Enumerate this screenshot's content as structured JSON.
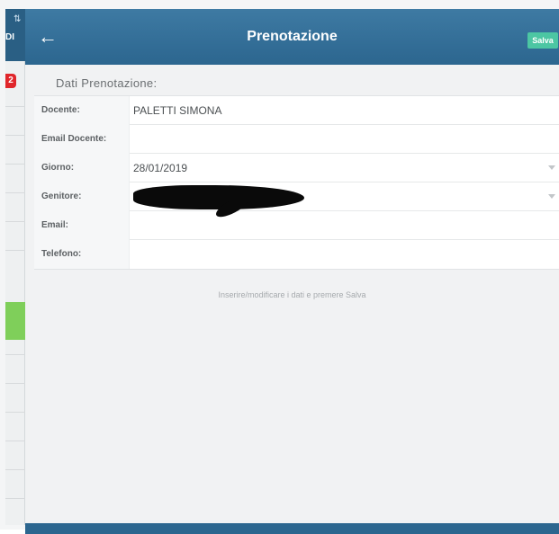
{
  "sidebar": {
    "header_text": "DI",
    "badge": "2"
  },
  "navbar": {
    "title": "Prenotazione",
    "back_icon": "arrow-left-icon",
    "save_label": "Salva"
  },
  "form": {
    "section_title": "Dati Prenotazione:",
    "rows": [
      {
        "label": "Docente:",
        "value": "PALETTI SIMONA"
      },
      {
        "label": "Email Docente:",
        "value": ""
      },
      {
        "label": "Giorno:",
        "value": "28/01/2019"
      },
      {
        "label": "Genitore:",
        "value": ""
      },
      {
        "label": "Email:",
        "value": ""
      },
      {
        "label": "Telefono:",
        "value": ""
      }
    ],
    "hint": "Inserire/modificare i dati e premere Salva"
  },
  "colors": {
    "navbar": "#2c668f",
    "save_button": "#4cc6a3",
    "badge": "#e0262b",
    "sidebar_selected": "#7fcf5a"
  }
}
